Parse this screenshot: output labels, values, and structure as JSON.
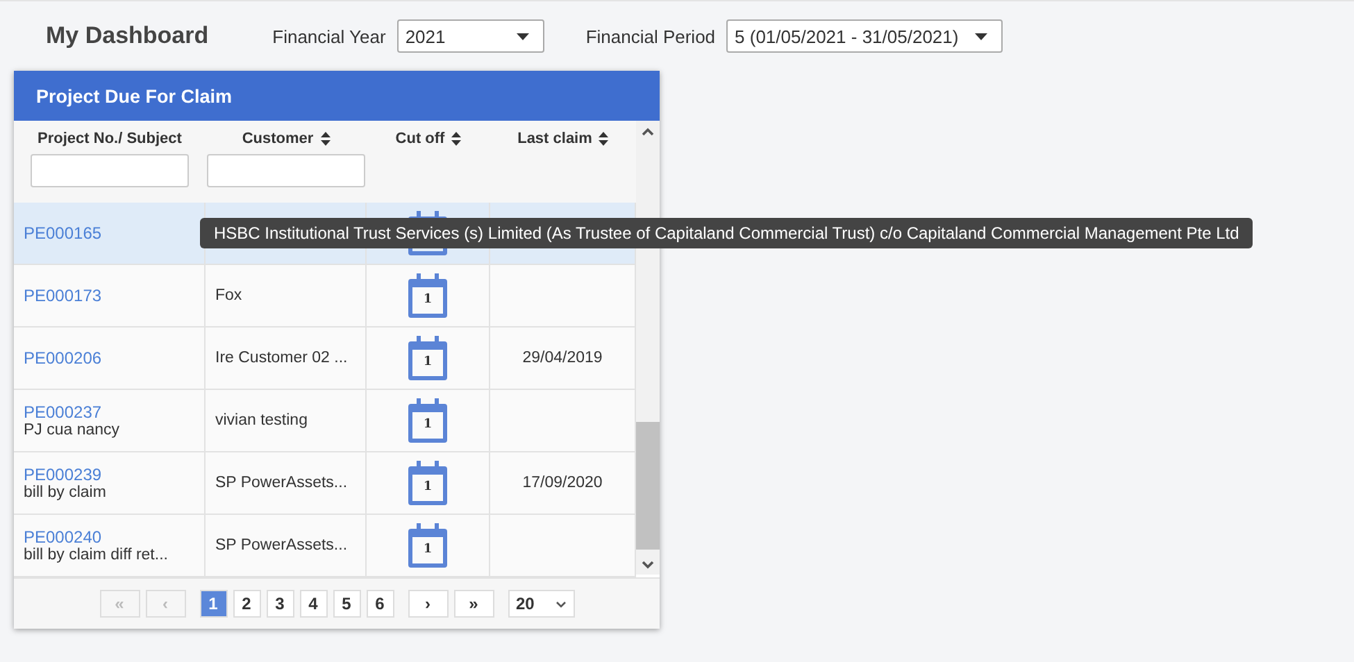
{
  "page_title": "My Dashboard",
  "filters": [
    {
      "label": "Financial Year",
      "value": "2021"
    },
    {
      "label": "Financial Period",
      "value": "5 (01/05/2021 - 31/05/2021)"
    }
  ],
  "panel": {
    "title": "Project Due For Claim",
    "columns": [
      {
        "label": "Project No./ Subject",
        "sortable": false,
        "filter": true
      },
      {
        "label": "Customer",
        "sortable": true,
        "filter": true
      },
      {
        "label": "Cut off",
        "sortable": true,
        "filter": false
      },
      {
        "label": "Last claim",
        "sortable": true,
        "filter": false
      }
    ],
    "rows": [
      {
        "project": "PE000165",
        "selected": true
      },
      {
        "project": "PE000173",
        "customer": "Fox",
        "selected": false,
        "cutoff": "1"
      },
      {
        "project": "PE000206",
        "customer": "Ire Customer 02 ...",
        "selected": false,
        "cutoff": "1",
        "last_claim": "29/04/2019"
      },
      {
        "project": "PE000237",
        "subject": "PJ cua nancy",
        "customer": "vivian testing",
        "selected": false,
        "cutoff": "1"
      },
      {
        "project": "PE000239",
        "subject": "bill by claim",
        "customer": "SP PowerAssets...",
        "selected": false,
        "cutoff": "1",
        "last_claim": "17/09/2020"
      },
      {
        "project": "PE000240",
        "subject": "bill by claim diff ret...",
        "customer": "SP PowerAssets...",
        "selected": false,
        "cutoff": "1"
      }
    ],
    "pagination": {
      "first": {
        "label": "«",
        "disabled": true
      },
      "prev": {
        "label": "‹",
        "disabled": true
      },
      "pages": [
        {
          "label": "1",
          "selected": true
        },
        {
          "label": "2",
          "selected": false
        },
        {
          "label": "3",
          "selected": false
        },
        {
          "label": "4",
          "selected": false
        },
        {
          "label": "5",
          "selected": false
        },
        {
          "label": "6",
          "selected": false
        }
      ],
      "next": {
        "label": "›",
        "disabled": false
      },
      "last": {
        "label": "»",
        "disabled": false
      },
      "page_size": "20"
    }
  },
  "tooltip": "HSBC Institutional Trust Services (s) Limited (As Trustee of Capitaland Commercial Trust) c/o Capitaland Commercial Management Pte Ltd"
}
